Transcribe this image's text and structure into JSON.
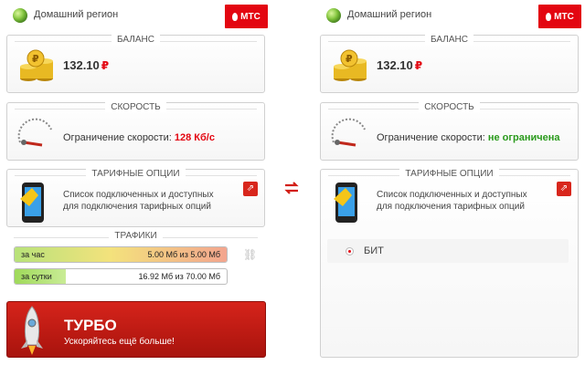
{
  "region": "Домашний регион",
  "brand": "МТС",
  "colors": {
    "brand_red": "#e30611",
    "limited": "#e30611",
    "unlimited": "#2a9a1c"
  },
  "left": {
    "balance": {
      "title": "БАЛАНС",
      "amount": "132.10",
      "currency": "₽"
    },
    "speed": {
      "title": "СКОРОСТЬ",
      "label": "Ограничение скорости:",
      "value": "128 Кб/с"
    },
    "options": {
      "title": "ТАРИФНЫЕ ОПЦИИ",
      "text_line1": "Список подключенных и доступных",
      "text_line2": "для подключения тарифных опций"
    },
    "traffic": {
      "title": "ТРАФИКИ",
      "rows": [
        {
          "label": "за час",
          "amount": "5.00 Мб из 5.00 Мб",
          "fraction": 1.0
        },
        {
          "label": "за сутки",
          "amount": "16.92 Мб из 70.00 Мб",
          "fraction": 0.2417
        }
      ]
    },
    "turbo": {
      "title": "ТУРБО",
      "subtitle": "Ускоряйтесь ещё больше!"
    }
  },
  "right": {
    "balance": {
      "title": "БАЛАНС",
      "amount": "132.10",
      "currency": "₽"
    },
    "speed": {
      "title": "СКОРОСТЬ",
      "label": "Ограничение скорости:",
      "value": "не ограничена"
    },
    "options": {
      "title": "ТАРИФНЫЕ ОПЦИИ",
      "text_line1": "Список подключенных и доступных",
      "text_line2": "для подключения тарифных опций",
      "items": [
        {
          "label": "БИТ"
        }
      ]
    }
  },
  "icons": {
    "swap": "swap-arrows-icon",
    "link": "external-link-icon",
    "chain": "chain-link-icon",
    "globe": "globe-icon"
  }
}
